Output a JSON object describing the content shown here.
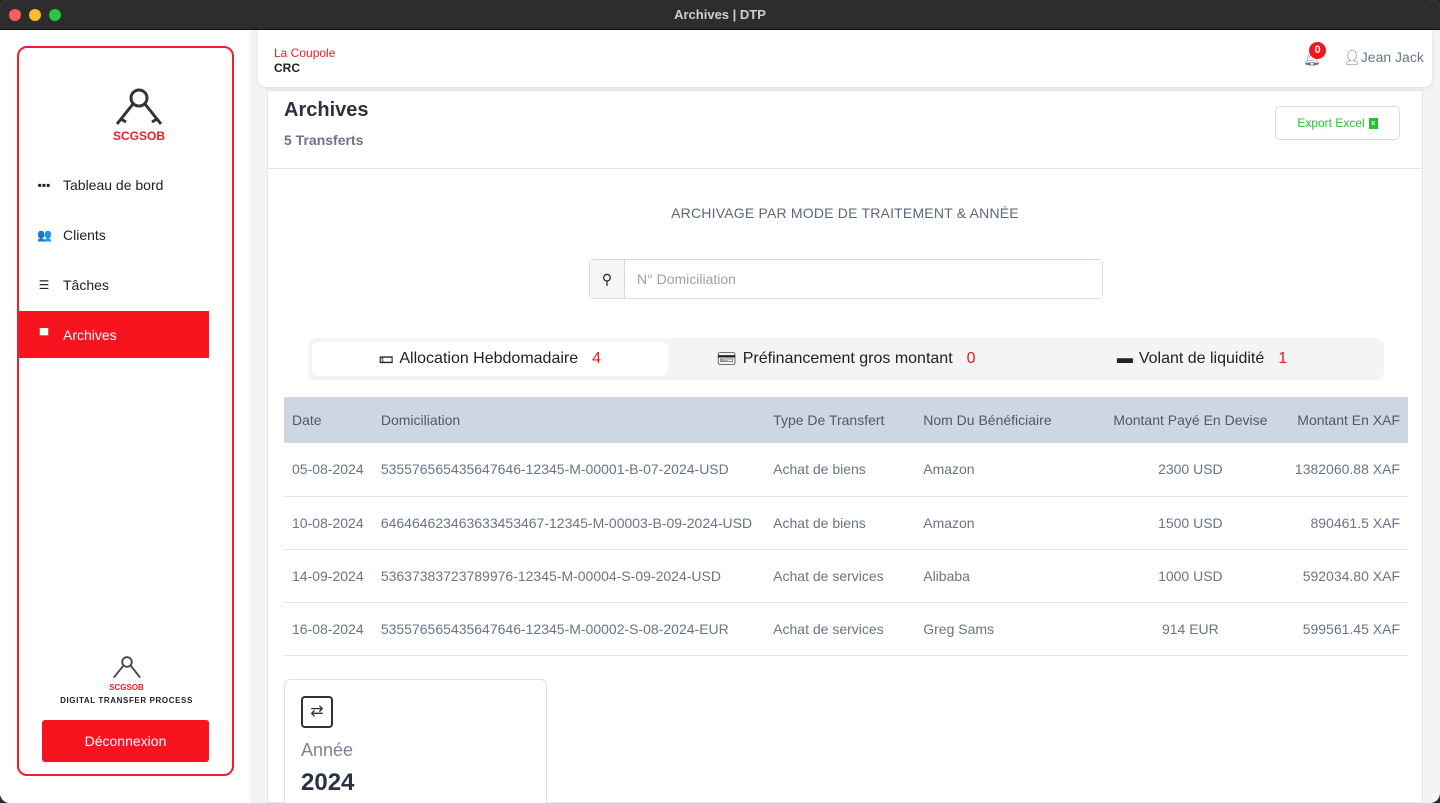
{
  "window": {
    "title": "Archives | DTP"
  },
  "sidebar": {
    "logo_text": "SCGSOB",
    "items": [
      {
        "label": "Tableau de bord",
        "icon": "grid-icon"
      },
      {
        "label": "Clients",
        "icon": "users-icon"
      },
      {
        "label": "Tâches",
        "icon": "tasks-icon"
      },
      {
        "label": "Archives",
        "icon": "archive-icon",
        "active": true
      }
    ],
    "bottom_logo_text": "SCGSOB",
    "bottom_caption": "DIGITAL TRANSFER PROCESS",
    "logout_label": "Déconnexion"
  },
  "header": {
    "org_name": "La Coupole",
    "org_code": "CRC",
    "notifications": "0",
    "user": "Jean Jack"
  },
  "main": {
    "title": "Archives",
    "subtitle": "5 Transferts",
    "export_label": "Export Excel",
    "section_title": "ARCHIVAGE PAR MODE DE TRAITEMENT & ANNÉE",
    "search": {
      "placeholder": "N° Domiciliation",
      "value": ""
    },
    "tabs": [
      {
        "label": "Allocation Hebdomadaire",
        "count": "4",
        "icon": "money-bill-icon",
        "active": true
      },
      {
        "label": "Préfinancement gros montant",
        "count": "0",
        "icon": "money-check-icon"
      },
      {
        "label": "Volant de liquidité",
        "count": "1",
        "icon": "wallet-icon"
      }
    ],
    "table": {
      "headers": [
        "Date",
        "Domiciliation",
        "Type De Transfert",
        "Nom Du Bénéficiaire",
        "Montant Payé En Devise",
        "Montant En XAF"
      ],
      "rows": [
        [
          "05-08-2024",
          "535576565435647646-12345-M-00001-B-07-2024-USD",
          "Achat de biens",
          "Amazon",
          "2300 USD",
          "1382060.88 XAF"
        ],
        [
          "10-08-2024",
          "646464623463633453467-12345-M-00003-B-09-2024-USD",
          "Achat de biens",
          "Amazon",
          "1500 USD",
          "890461.5 XAF"
        ],
        [
          "14-09-2024",
          "53637383723789976-12345-M-00004-S-09-2024-USD",
          "Achat de services",
          "Alibaba",
          "1000 USD",
          "592034.80 XAF"
        ],
        [
          "16-08-2024",
          "535576565435647646-12345-M-00002-S-08-2024-EUR",
          "Achat de services",
          "Greg Sams",
          "914 EUR",
          "599561.45 XAF"
        ]
      ]
    },
    "year_card": {
      "label": "Année",
      "value": "2024"
    }
  }
}
